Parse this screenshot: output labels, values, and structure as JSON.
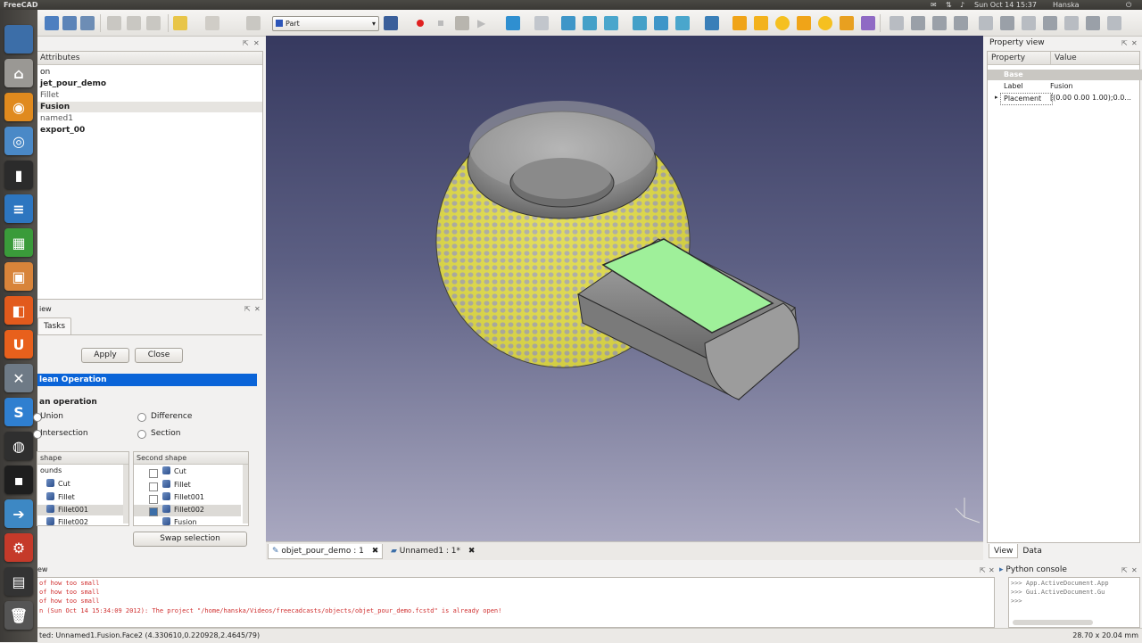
{
  "topbar": {
    "app_title": "FreeCAD",
    "datetime": "Sun Oct 14 15:37",
    "user": "Hanska"
  },
  "toolbar": {
    "workbench": "Part"
  },
  "tree": {
    "header": "Attributes",
    "items": [
      "on",
      "jet_pour_demo",
      "Fillet",
      "Fusion",
      "named1",
      "export_00"
    ]
  },
  "combo": {
    "header": "iew",
    "tab_tasks": "Tasks",
    "apply": "Apply",
    "close": "Close",
    "panel_title": "lean Operation",
    "section_label": "an operation",
    "op_union": "Union",
    "op_difference": "Difference",
    "op_intersection": "Intersection",
    "op_section": "Section",
    "first_shape_header": "shape",
    "first_shape_items": [
      "ounds",
      "Cut",
      "Fillet",
      "Fillet001",
      "Fillet002"
    ],
    "second_shape_header": "Second shape",
    "second_shape_items": [
      "Cut",
      "Fillet",
      "Fillet001",
      "Fillet002",
      "Fusion"
    ],
    "swap": "Swap selection"
  },
  "doc_tabs": [
    {
      "label": "objet_pour_demo : 1"
    },
    {
      "label": "Unnamed1 : 1*"
    }
  ],
  "property_view": {
    "header": "Property view",
    "col_property": "Property",
    "col_value": "Value",
    "group": "Base",
    "rows": [
      {
        "name": "Label",
        "value": "Fusion"
      },
      {
        "name": "Placement",
        "value": "[(0.00 0.00 1.00);0.0..."
      }
    ],
    "tab_view": "View",
    "tab_data": "Data"
  },
  "report": {
    "header": "ew",
    "lines": [
      "of how too small",
      "of how too small",
      "of how too small",
      "n (Sun Oct 14 15:34:09 2012): The project \"/home/hanska/Videos/freecadcasts/objects/objet_pour_demo.fcstd\" is already open!"
    ]
  },
  "python_console": {
    "header": "Python console",
    "lines": [
      ">>> App.ActiveDocument.App",
      ">>> Gui.ActiveDocument.Gu",
      ">>>"
    ]
  },
  "status": {
    "left": "ted: Unnamed1.Fusion.Face2 (4.330610,0.220928,2.4645/79)",
    "right": "28.70 x 20.04 mm"
  },
  "colors": {
    "viewport_top": "#36395f",
    "viewport_bottom": "#a9a8c0",
    "selection": "#0a64d8",
    "highlight_face": "#9ff09a"
  }
}
